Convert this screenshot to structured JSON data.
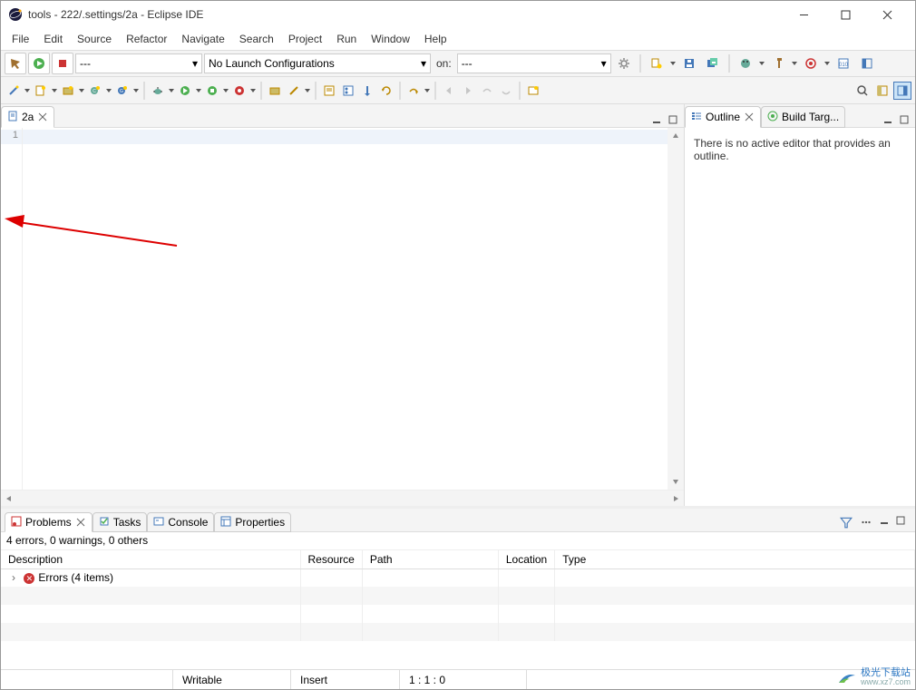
{
  "window": {
    "title": "tools - 222/.settings/2a - Eclipse IDE"
  },
  "menubar": {
    "items": [
      "File",
      "Edit",
      "Source",
      "Refactor",
      "Navigate",
      "Search",
      "Project",
      "Run",
      "Window",
      "Help"
    ]
  },
  "toolbar1": {
    "launch_combo1": "---",
    "launch_combo2": "No Launch Configurations",
    "on_label": "on:",
    "on_combo": "---"
  },
  "editor": {
    "tab_label": "2a",
    "line_numbers": [
      "1"
    ]
  },
  "outline": {
    "tab_outline": "Outline",
    "tab_build": "Build Targ...",
    "message": "There is no active editor that provides an outline."
  },
  "bottom": {
    "tabs": {
      "problems": "Problems",
      "tasks": "Tasks",
      "console": "Console",
      "properties": "Properties"
    },
    "summary": "4 errors, 0 warnings, 0 others",
    "columns": [
      "Description",
      "Resource",
      "Path",
      "Location",
      "Type"
    ],
    "rows": [
      {
        "description": "Errors (4 items)"
      }
    ]
  },
  "statusbar": {
    "writable": "Writable",
    "insert": "Insert",
    "pos": "1 : 1 : 0"
  },
  "watermark": {
    "cn": "极光下载站",
    "url": "www.xz7.com"
  }
}
